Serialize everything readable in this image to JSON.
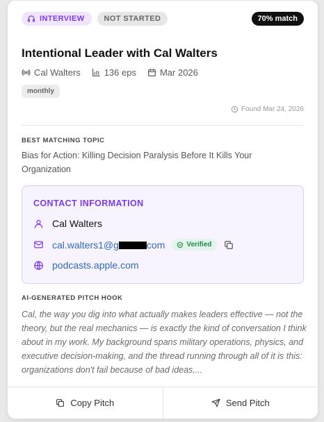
{
  "badges": {
    "type": "INTERVIEW",
    "status": "NOT STARTED",
    "match": "70% match"
  },
  "podcast": {
    "title": "Intentional Leader with Cal Walters",
    "host": "Cal Walters",
    "episodes": "136 eps",
    "date": "Mar 2026",
    "frequency": "monthly",
    "found": "Found Mar 24, 2026"
  },
  "topic": {
    "label": "BEST MATCHING TOPIC",
    "text": "Bias for Action: Killing Decision Paralysis Before It Kills Your Organization"
  },
  "contact": {
    "header": "CONTACT INFORMATION",
    "name": "Cal Walters",
    "email_prefix": "cal.walters1@g",
    "email_suffix": "com",
    "verified": "Verified",
    "website": "podcasts.apple.com"
  },
  "hook": {
    "label": "AI-GENERATED PITCH HOOK",
    "text": "Cal, the way you dig into what actually makes leaders effective — not the theory, but the real mechanics — is exactly the kind of conversation I think about in my work. My background spans military operations, physics, and executive decision-making, and the thread running through all of it is this: organizations don't fail because of bad ideas,..."
  },
  "actions": {
    "copy": "Copy Pitch",
    "send": "Send Pitch"
  },
  "colors": {
    "accent": "#7c3aed",
    "link": "#2f6bbf",
    "verified": "#24874d"
  }
}
